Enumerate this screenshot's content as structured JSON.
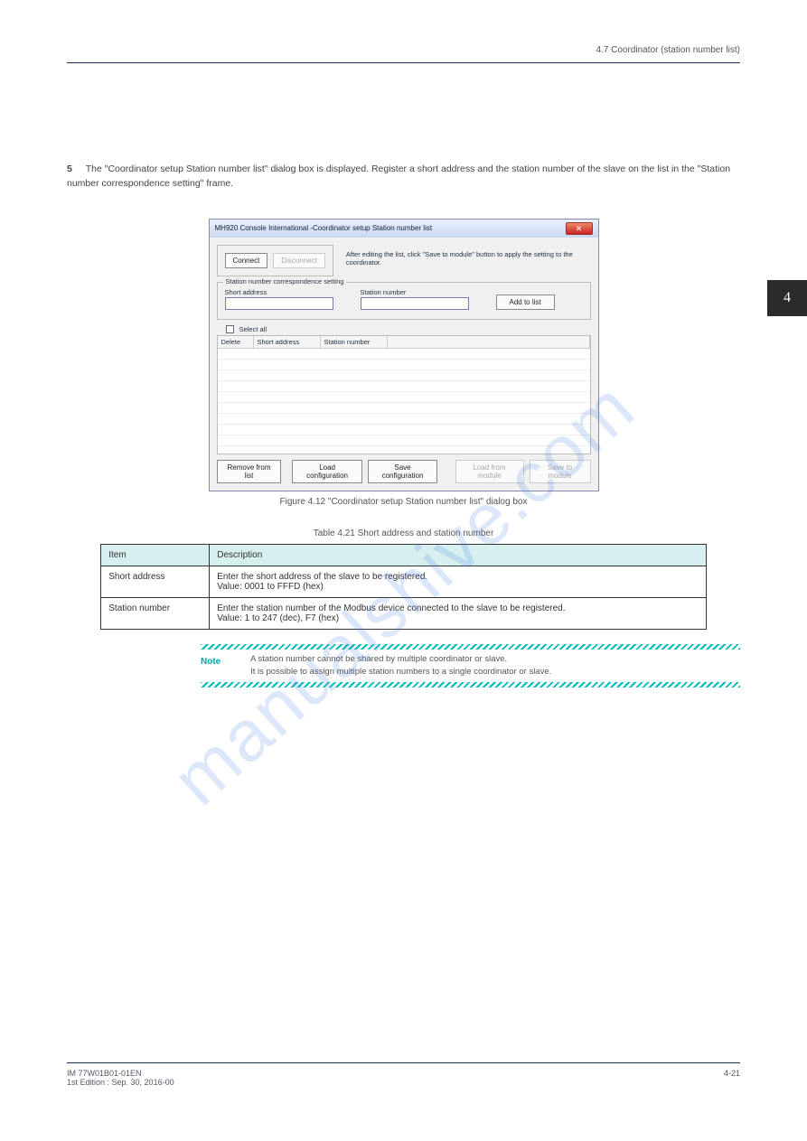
{
  "header": {
    "title": "4.7 Coordinator (station number list)"
  },
  "sideTab": "4",
  "step": {
    "num": "5",
    "text": "The \"Coordinator setup Station number list\" dialog box is displayed. Register a short address and the station number of the slave on the list in the \"Station number correspondence setting\" frame."
  },
  "dialog": {
    "title": "MH920 Console International -Coordinator setup Station number list",
    "connect": "Connect",
    "disconnect": "Disconnect",
    "info": "After editing the list, click \"Save to module\" button to apply the setting to the coordinator.",
    "fieldsetTitle": "Station number correspondence setting",
    "shortAddrLabel": "Short address",
    "stationNumLabel": "Station number",
    "addBtn": "Add to list",
    "selectAll": "Select all",
    "cols": {
      "delete": "Delete",
      "shortAddr": "Short address",
      "stationNum": "Station number"
    },
    "removeBtn": "Remove from list",
    "loadCfg": "Load configuration",
    "saveCfg": "Save configuration",
    "loadMod": "Load from module",
    "saveMod": "Save to module"
  },
  "figCaption": "Figure 4.12  \"Coordinator setup Station number list\" dialog box",
  "tableCaption": "Table 4.21  Short address and station number",
  "specTable": {
    "headItem": "Item",
    "headDesc": "Description",
    "rows": [
      {
        "item": "Short address",
        "desc": "Enter the short address of the slave to be registered.\nValue: 0001 to FFFD (hex)"
      },
      {
        "item": "Station number",
        "desc": "Enter the station number of the Modbus device connected to the slave to be registered.\nValue: 1 to 247 (dec), F7 (hex)"
      }
    ]
  },
  "note": {
    "label": "Note",
    "text": "A station number cannot be shared by multiple coordinator or slave.\nIt is possible to assign multiple station numbers to a single coordinator or slave."
  },
  "footer": {
    "left": "IM 77W01B01-01EN\n1st Edition : Sep. 30, 2016-00",
    "right": "4-21"
  },
  "watermark": "manualshive.com"
}
